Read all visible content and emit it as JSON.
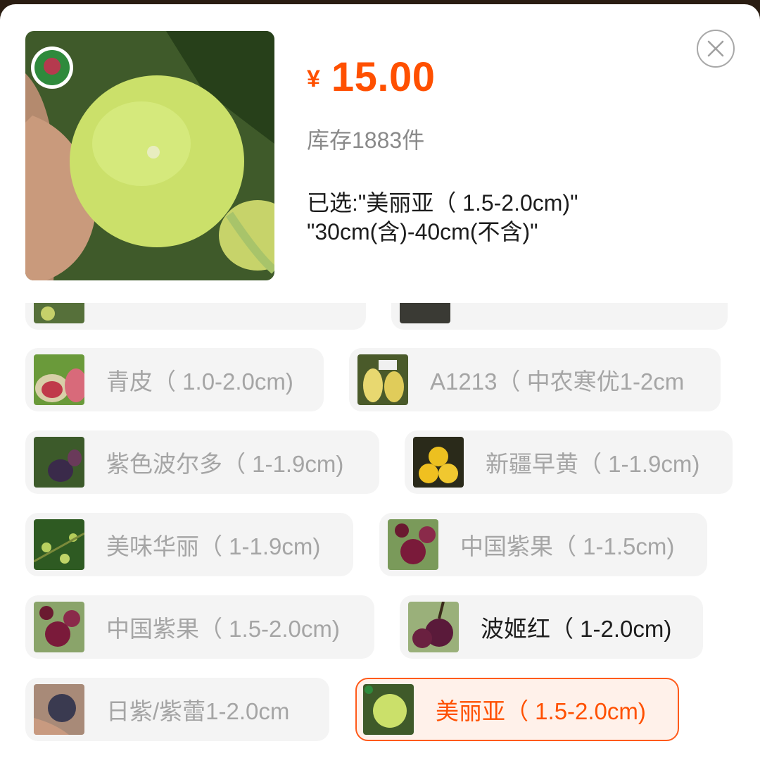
{
  "product": {
    "currency_symbol": "¥",
    "price": "15.00",
    "stock_text": "库存1883件",
    "selected_line1": "已选:\"美丽亚（ 1.5-2.0cm)\"",
    "selected_line2": "\"30cm(含)-40cm(不含)\"",
    "image_icon": "green-fig-photo",
    "watermark_icon": "shop-logo-seal"
  },
  "options": [
    {
      "label": "",
      "state": "disabled",
      "icon": "fig-thumbnail"
    },
    {
      "label": "",
      "state": "disabled",
      "icon": "fig-thumbnail"
    },
    {
      "label": "青皮（ 1.0-2.0cm)",
      "state": "disabled",
      "icon": "cut-fig-thumbnail"
    },
    {
      "label": "A1213（ 中农寒优1-2cm",
      "state": "disabled",
      "icon": "yellow-fig-thumbnail"
    },
    {
      "label": "紫色波尔多（ 1-1.9cm)",
      "state": "disabled",
      "icon": "purple-fig-thumbnail"
    },
    {
      "label": "新疆早黄（ 1-1.9cm)",
      "state": "disabled",
      "icon": "yellow-fig-thumbnail"
    },
    {
      "label": "美味华丽（ 1-1.9cm)",
      "state": "disabled",
      "icon": "fig-tree-thumbnail"
    },
    {
      "label": "中国紫果（ 1-1.5cm)",
      "state": "disabled",
      "icon": "purple-fig-thumbnail"
    },
    {
      "label": "中国紫果（ 1.5-2.0cm)",
      "state": "disabled",
      "icon": "purple-fig-thumbnail"
    },
    {
      "label": "波姬红（ 1-2.0cm)",
      "state": "normal",
      "icon": "purple-fig-thumbnail"
    },
    {
      "label": "日紫/紫蕾1-2.0cm",
      "state": "disabled",
      "icon": "dark-fig-thumbnail"
    },
    {
      "label": "美丽亚（ 1.5-2.0cm)",
      "state": "selected",
      "icon": "green-fig-thumbnail"
    }
  ],
  "colors": {
    "accent": "#ff5000",
    "option_bg": "#f4f4f4",
    "disabled_text": "#a5a5a5",
    "normal_text": "#1d1d1d"
  }
}
